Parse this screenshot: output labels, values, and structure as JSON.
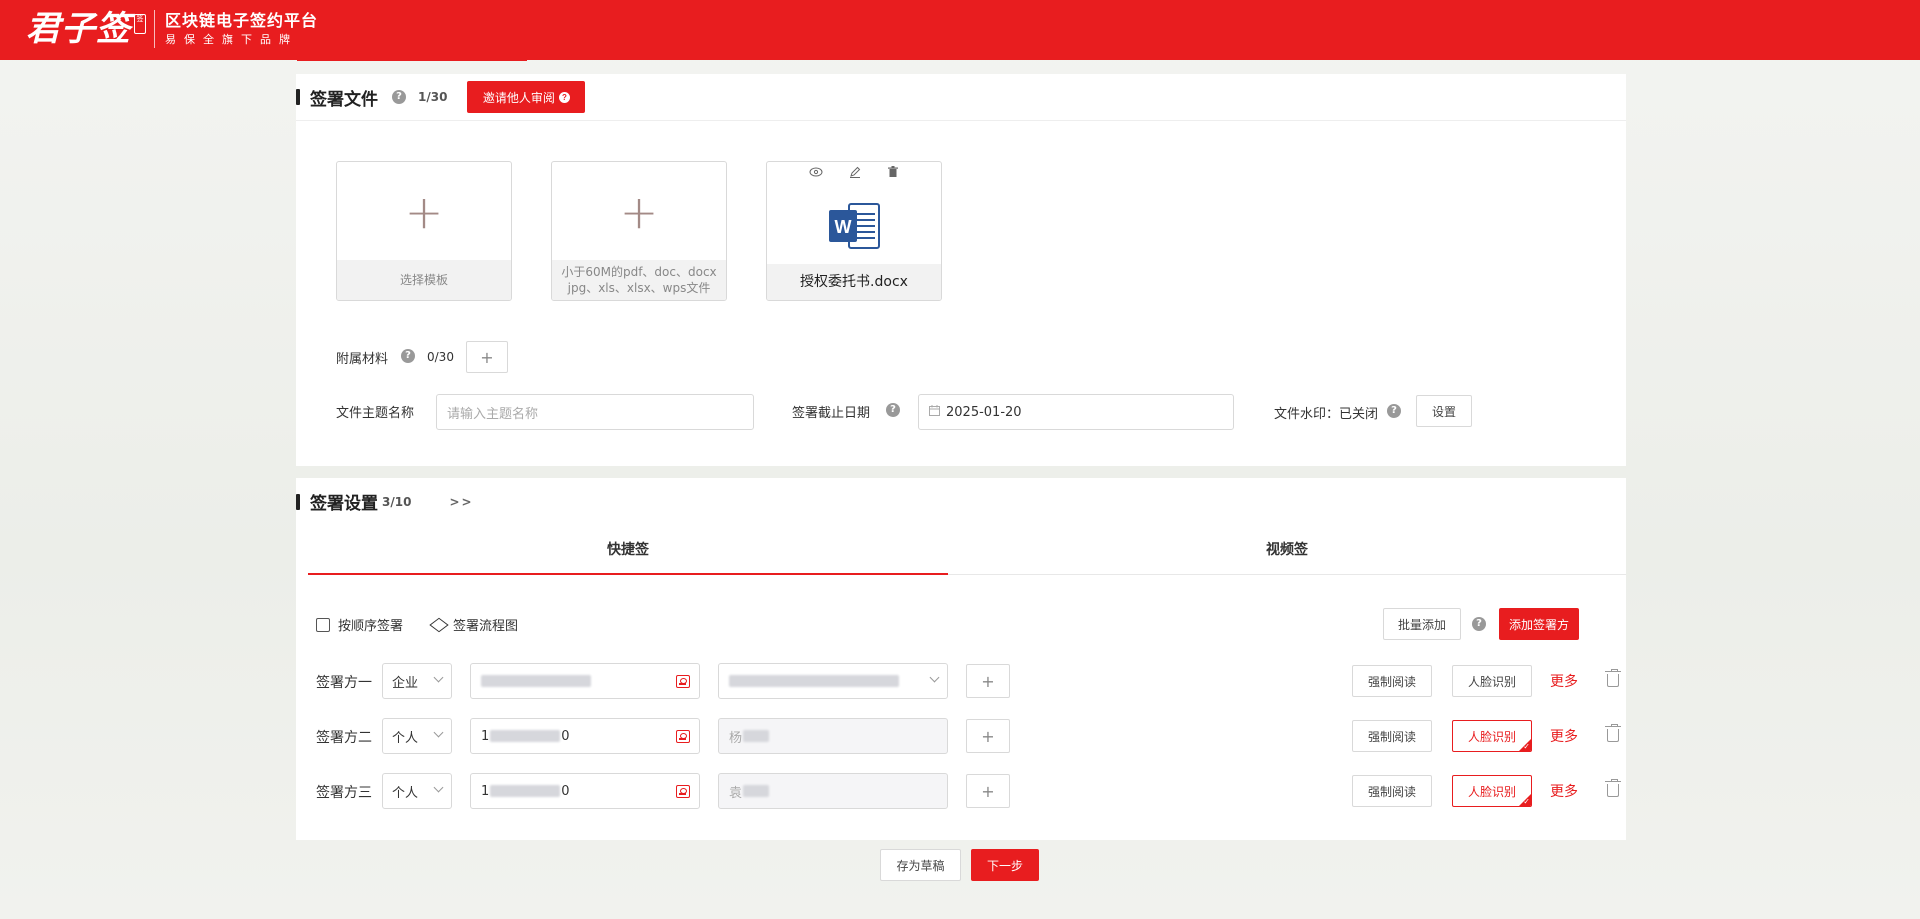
{
  "header": {
    "logo_text": "君子签",
    "logo_seal": "签",
    "platform_title": "区块链电子签约平台",
    "platform_sub": "易保全旗下品牌"
  },
  "files_section": {
    "title": "签署文件",
    "help": "?",
    "count": "1/30",
    "invite_button": "邀请他人审阅",
    "cards": {
      "template_label": "选择模板",
      "upload_hint": "小于60M的pdf、doc、docx jpg、xls、xlsx、wps文件",
      "uploaded_name": "授权委托书.docx"
    },
    "attachments_label": "附属材料",
    "attachments_count": "0/30",
    "subject_label": "文件主题名称",
    "subject_placeholder": "请输入主题名称",
    "deadline_label": "签署截止日期",
    "deadline_value": "2025-01-20",
    "watermark_label": "文件水印：已关闭",
    "watermark_button": "设置"
  },
  "sign_section": {
    "title": "签署设置",
    "count": "3/10",
    "arrows": ">>",
    "tabs": [
      "快捷签",
      "视频签"
    ],
    "sequential_label": "按顺序签署",
    "flowchart_label": "签署流程图",
    "batch_add": "批量添加",
    "add_signer": "添加签署方",
    "signers": [
      {
        "label": "签署方一",
        "type": "企业",
        "account_prefix": "",
        "account_suffix": "",
        "name_prefix": "",
        "face_on": false
      },
      {
        "label": "签署方二",
        "type": "个人",
        "account_prefix": "1",
        "account_suffix": "0",
        "name_prefix": "杨",
        "face_on": true
      },
      {
        "label": "签署方三",
        "type": "个人",
        "account_prefix": "1",
        "account_suffix": "0",
        "name_prefix": "袁",
        "face_on": true
      }
    ],
    "force_read": "强制阅读",
    "face_recognition": "人脸识别",
    "more": "更多"
  },
  "footer": {
    "save_draft": "存为草稿",
    "next": "下一步"
  },
  "colors": {
    "brand": "#e81d1f",
    "word_blue": "#2b579a"
  }
}
